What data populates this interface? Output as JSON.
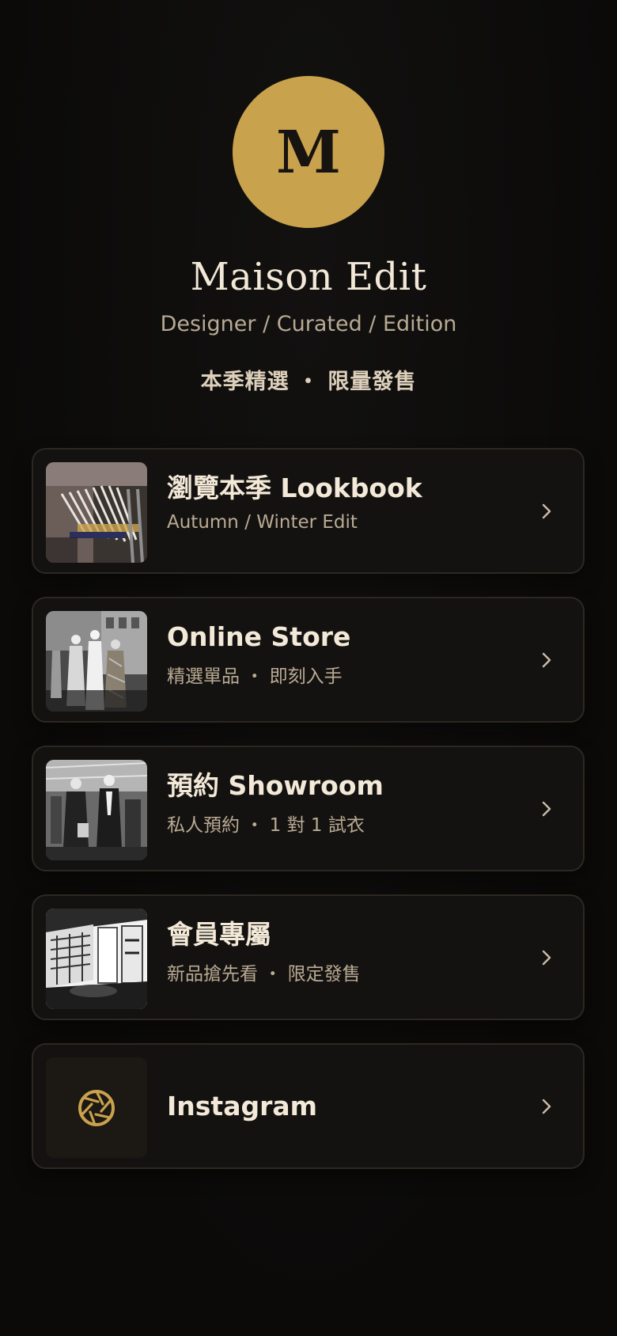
{
  "profile": {
    "initial": "M",
    "name": "Maison Edit",
    "tagline": "Designer / Curated / Edition",
    "motto": "本季精選 ・ 限量發售",
    "accent_color": "#c9a24d"
  },
  "links": [
    {
      "title": "瀏覽本季 Lookbook",
      "subtitle": "Autumn / Winter Edit",
      "thumbnail": "clothing-rack-photo"
    },
    {
      "title": "Online Store",
      "subtitle": "精選單品 ・ 即刻入手",
      "thumbnail": "mannequins-photo"
    },
    {
      "title": "預約 Showroom",
      "subtitle": "私人預約 ・ 1 對 1 試衣",
      "thumbnail": "showroom-window-photo"
    },
    {
      "title": "會員專屬",
      "subtitle": "新品搶先看 ・ 限定發售",
      "thumbnail": "store-interior-photo"
    },
    {
      "title": "Instagram",
      "icon": "aperture-icon"
    }
  ]
}
